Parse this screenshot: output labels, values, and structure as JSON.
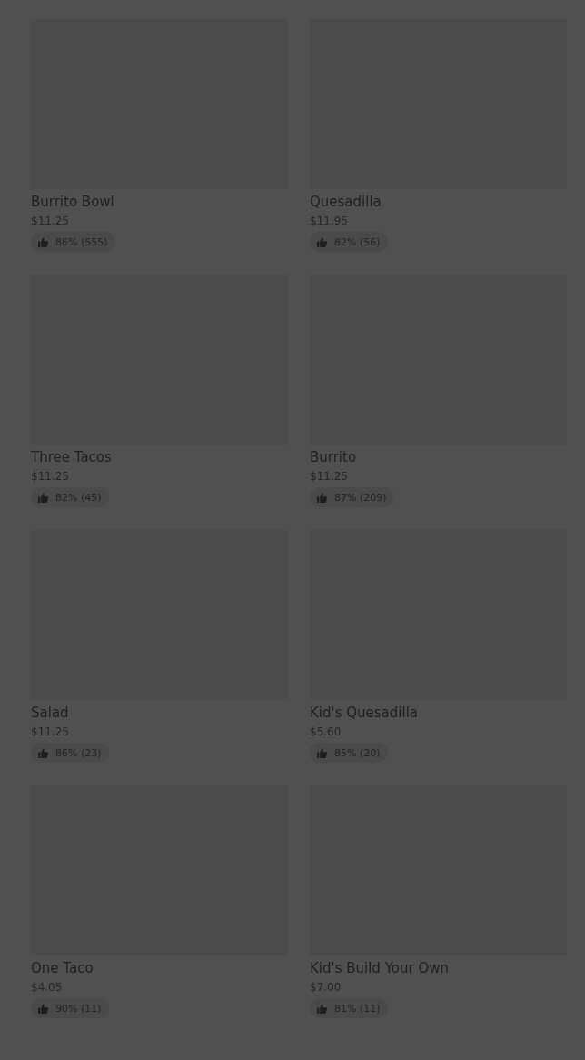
{
  "items": [
    {
      "name": "Burrito Bowl",
      "price": "$11.25",
      "rating": "86% (555)"
    },
    {
      "name": "Quesadilla",
      "price": "$11.95",
      "rating": "82% (56)"
    },
    {
      "name": "Three Tacos",
      "price": "$11.25",
      "rating": "82% (45)"
    },
    {
      "name": "Burrito",
      "price": "$11.25",
      "rating": "87% (209)"
    },
    {
      "name": "Salad",
      "price": "$11.25",
      "rating": "86% (23)"
    },
    {
      "name": "Kid's Quesadilla",
      "price": "$5.60",
      "rating": "85% (20)"
    },
    {
      "name": "One Taco",
      "price": "$4.05",
      "rating": "90% (11)"
    },
    {
      "name": "Kid's Build Your Own",
      "price": "$7.00",
      "rating": "81% (11)"
    }
  ]
}
